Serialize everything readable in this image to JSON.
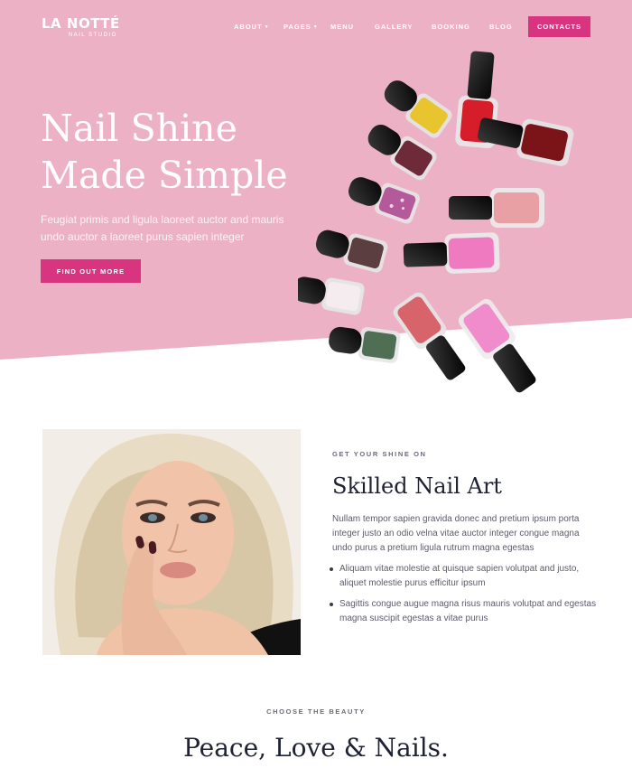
{
  "brand": {
    "name": "LA NOTTÉ",
    "tagline": "NAIL STUDIO"
  },
  "nav": {
    "items": [
      {
        "label": "ABOUT",
        "has_dropdown": true
      },
      {
        "label": "PAGES",
        "has_dropdown": true
      },
      {
        "label": "MENU",
        "has_dropdown": false
      },
      {
        "label": "GALLERY",
        "has_dropdown": false
      },
      {
        "label": "BOOKING",
        "has_dropdown": false
      },
      {
        "label": "BLOG",
        "has_dropdown": false
      }
    ],
    "cta_label": "CONTACTS",
    "caret_icon": "chevron-down-icon"
  },
  "hero": {
    "title_line1": "Nail Shine",
    "title_line2": "Made Simple",
    "subtitle": "Feugiat primis and ligula laoreet auctor and mauris undo auctor a laoreet purus sapien integer",
    "button_label": "FIND OUT MORE"
  },
  "feature": {
    "eyebrow": "GET YOUR SHINE ON",
    "title": "Skilled Nail Art",
    "paragraph": "Nullam tempor sapien gravida donec and pretium ipsum porta integer justo an odio velna vitae auctor integer congue magna undo purus a pretium ligula rutrum magna egestas",
    "bullets": [
      "Aliquam vitae molestie at quisque sapien volutpat and justo, aliquet molestie purus efficitur ipsum",
      "Sagittis congue augue magna risus mauris volutpat and egestas magna suscipit egestas a vitae purus"
    ]
  },
  "next_section": {
    "eyebrow": "CHOOSE THE BEAUTY",
    "title": "Peace, Love & Nails."
  },
  "colors": {
    "hero_pink": "#edb1c6",
    "accent": "#d8347f",
    "heading_dark": "#1f2233",
    "body_text": "#5b5b6b"
  }
}
